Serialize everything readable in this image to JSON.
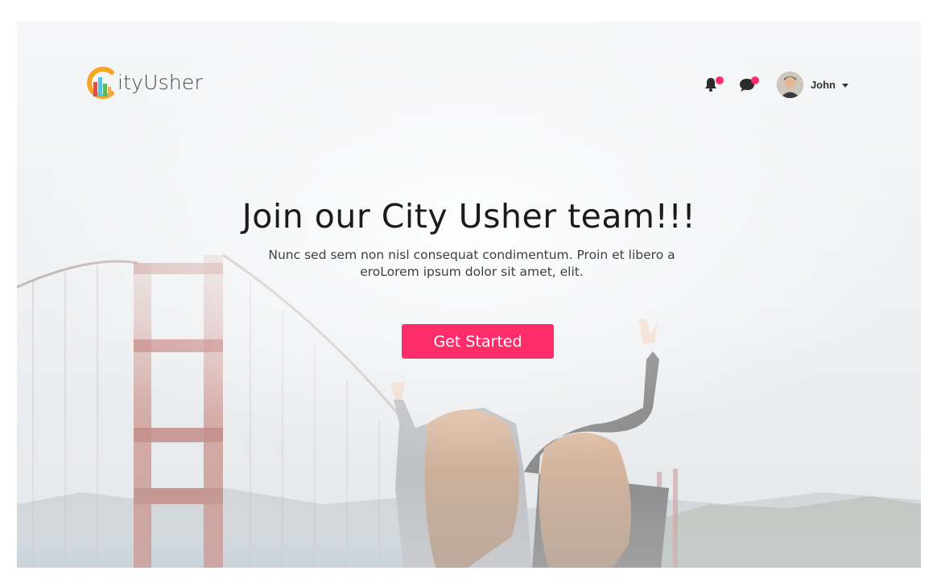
{
  "header": {
    "logo_text": "ityUsher",
    "notifications": {
      "icon": "bell-icon",
      "has_unread": true
    },
    "messages": {
      "icon": "chat-icon",
      "has_unread": true
    },
    "user": {
      "name": "John",
      "avatar": "user-avatar",
      "menu_icon": "caret-down-icon"
    }
  },
  "hero": {
    "title": "Join our City Usher team!!!",
    "subtitle": "Nunc sed sem non nisl consequat condimentum. Proin et libero a eroLorem ipsum dolor sit amet, elit.",
    "cta_label": "Get Started"
  },
  "colors": {
    "accent": "#ff2d6a",
    "text_dark": "#1b1b1b",
    "logo_orange": "#f5a623",
    "bridge_red": "#a8463f"
  }
}
